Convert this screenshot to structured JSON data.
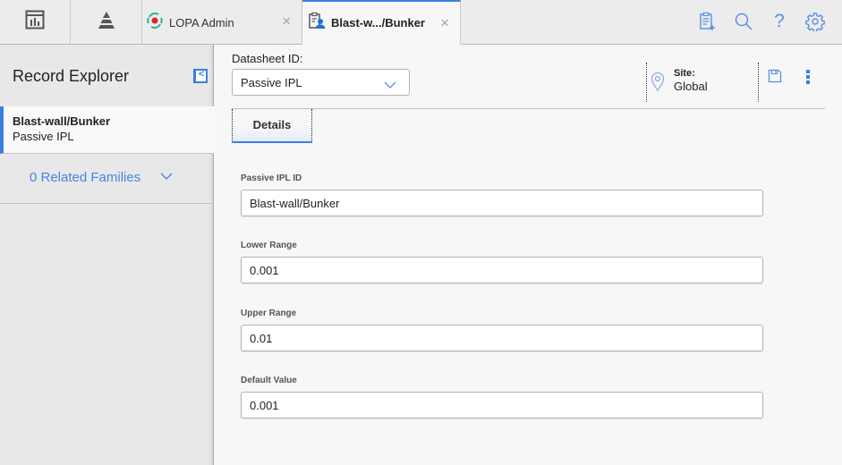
{
  "topbar": {
    "tabs": [
      {
        "label": "LOPA Admin",
        "icon": "lopa-admin-icon"
      },
      {
        "label": "Blast-w.../Bunker",
        "icon": "record-user-icon"
      }
    ],
    "close_glyph": "×",
    "actions": [
      "new-record-icon",
      "search-icon",
      "help-icon",
      "gear-icon"
    ],
    "help_glyph": "?"
  },
  "sidebar": {
    "title": "Record Explorer",
    "collapse_glyph": "<",
    "record": {
      "name": "Blast-wall/Bunker",
      "family": "Passive IPL"
    },
    "related": {
      "label": "0 Related Families"
    }
  },
  "main": {
    "datasheet_label": "Datasheet ID:",
    "datasheet_value": "Passive IPL",
    "site_label": "Site:",
    "site_value": "Global",
    "details_tab": "Details",
    "fields": [
      {
        "label": "Passive IPL ID",
        "value": "Blast-wall/Bunker"
      },
      {
        "label": "Lower Range",
        "value": "0.001"
      },
      {
        "label": "Upper Range",
        "value": "0.01"
      },
      {
        "label": "Default Value",
        "value": "0.001"
      }
    ]
  },
  "colors": {
    "accent": "#3b7fe0",
    "icon_blue": "#5b8ee6",
    "lopa_teal": "#1fb59b",
    "lopa_red": "#e02424"
  }
}
